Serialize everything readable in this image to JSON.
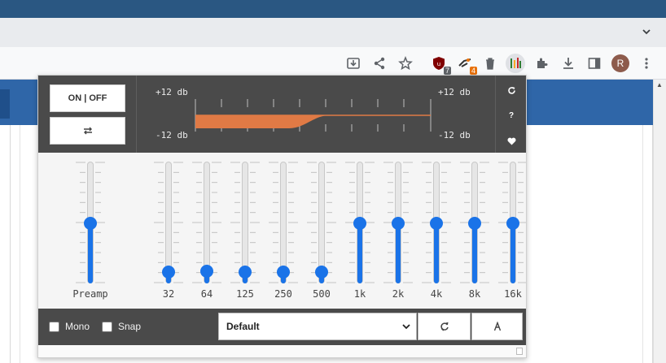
{
  "browser": {
    "toolbar_icons": [
      "install-icon",
      "share-icon",
      "star-icon",
      "ublock-icon",
      "shopping-ext-icon",
      "trash-ext-icon",
      "equalizer-ext-icon",
      "puzzle-icon",
      "download-icon",
      "side-panel-icon",
      "kebab-menu-icon"
    ],
    "ublock_badge": "7",
    "shopping_badge": "4",
    "avatar_initial": "R",
    "ublock_badge_color": "#5f6368",
    "shopping_badge_color": "#e8710a",
    "titlebar_color": "#2a5782"
  },
  "equalizer": {
    "power_label": "ON | OFF",
    "db_top_left": "+12 db",
    "db_bottom_left": "-12 db",
    "db_top_right": "+12 db",
    "db_bottom_right": "-12 db",
    "side_icons": [
      "reset-icon",
      "help-icon",
      "heart-icon"
    ],
    "curve_color": "#e07a45",
    "accent_color": "#1a73e8",
    "bands": [
      {
        "label": "Preamp",
        "level": 0.5
      },
      {
        "label": "32",
        "level": 0.1
      },
      {
        "label": "64",
        "level": 0.11
      },
      {
        "label": "125",
        "level": 0.1
      },
      {
        "label": "250",
        "level": 0.1
      },
      {
        "label": "500",
        "level": 0.1
      },
      {
        "label": "1k",
        "level": 0.5
      },
      {
        "label": "2k",
        "level": 0.5
      },
      {
        "label": "4k",
        "level": 0.5
      },
      {
        "label": "8k",
        "level": 0.5
      },
      {
        "label": "16k",
        "level": 0.5
      }
    ],
    "mono_label": "Mono",
    "snap_label": "Snap",
    "mono_checked": false,
    "snap_checked": false,
    "preset_selected": "Default",
    "preset_buttons": [
      "refresh-preset-icon",
      "font-a-icon"
    ]
  }
}
